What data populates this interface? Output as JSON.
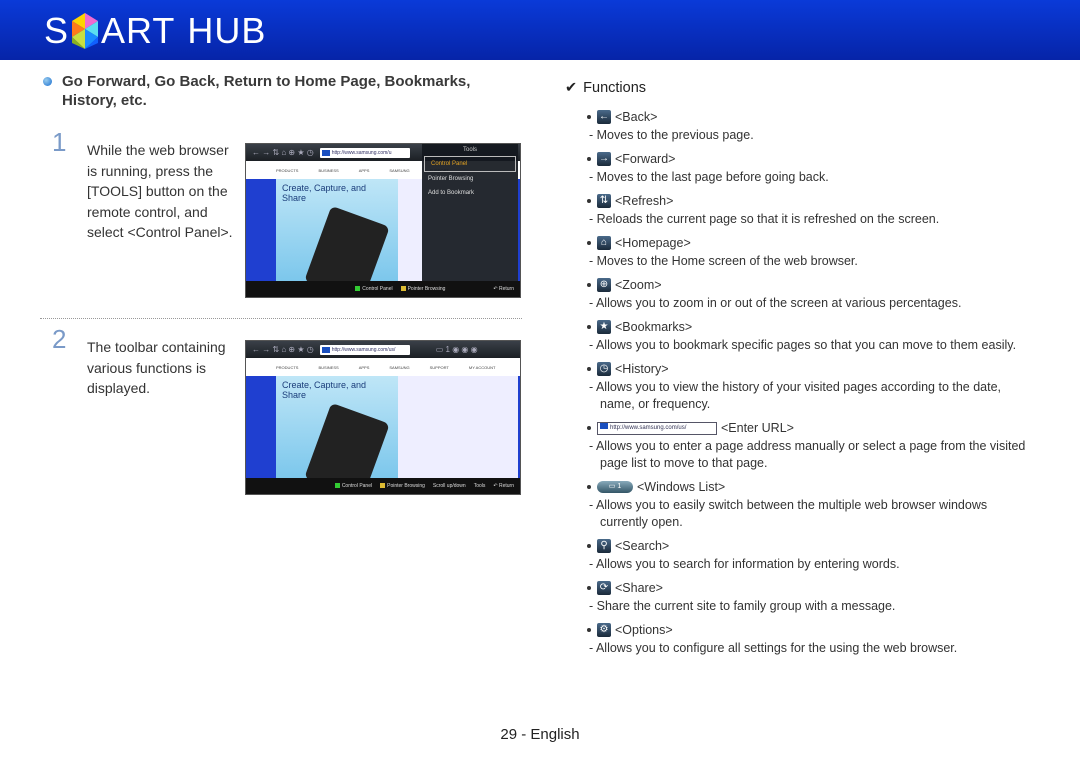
{
  "header": {
    "logo_text_1": "S",
    "logo_text_2": "ART",
    "logo_text_3": "HUB"
  },
  "section": {
    "heading": "Go Forward, Go Back, Return to Home Page, Bookmarks, History, etc."
  },
  "steps": [
    {
      "num": "1",
      "text_1": "While the web browser is running, press the [",
      "key": "TOOLS",
      "text_2": "] button on the remote control, and select <",
      "target": "Control Panel",
      "text_3": ">."
    },
    {
      "num": "2",
      "text": "The toolbar containing various functions is displayed."
    }
  ],
  "shot1": {
    "url": "http://www.samsung.com/u",
    "tools_title": "Tools",
    "menu": [
      "Control Panel",
      "Pointer Browsing",
      "Add to Bookmark"
    ],
    "hero": "Create, Capture, and Share",
    "nav": [
      "PRODUCTS",
      "BUSINESS",
      "APPS",
      "SAMSUNG",
      "SUPPORT"
    ],
    "bottom": [
      "Control Panel",
      "Pointer Browsing",
      "Return"
    ]
  },
  "shot2": {
    "url": "http://www.samsung.com/us/",
    "hero": "Create, Capture, and Share",
    "nav": [
      "PRODUCTS",
      "BUSINESS",
      "APPS",
      "SAMSUNG",
      "SUPPORT",
      "MY ACCOUNT"
    ],
    "bottom": [
      "Control Panel",
      "Pointer Browsing",
      "Scroll up/down",
      "Tools",
      "Return"
    ]
  },
  "functions": {
    "title": "Functions",
    "items": [
      {
        "icon": "back-arrow",
        "glyph": "←",
        "label": "<Back>",
        "desc": "Moves to the previous page."
      },
      {
        "icon": "forward-arrow",
        "glyph": "→",
        "label": "<Forward>",
        "desc": "Moves to the last page before going back."
      },
      {
        "icon": "refresh",
        "glyph": "⇅",
        "label": "<Refresh>",
        "desc": "Reloads the current page so that it is refreshed on the screen."
      },
      {
        "icon": "home",
        "glyph": "⌂",
        "label": "<Homepage>",
        "desc": "Moves to the Home screen of the web browser."
      },
      {
        "icon": "zoom",
        "glyph": "⊕",
        "label": "<Zoom>",
        "desc": "Allows you to zoom in or out of the screen at various percentages."
      },
      {
        "icon": "bookmark-star",
        "glyph": "★",
        "label": "<Bookmarks>",
        "desc": "Allows you to bookmark specific pages so that you can move to them easily."
      },
      {
        "icon": "history-clock",
        "glyph": "◷",
        "label": "<History>",
        "desc": "Allows you to view the history of your visited pages according to the date, name, or frequency."
      },
      {
        "icon": "url-field",
        "url": "http://www.samsung.com/us/",
        "label": "<Enter URL>",
        "desc": "Allows you to enter a page address manually or select a page from the visited page list to move to that page."
      },
      {
        "icon": "windows-list",
        "count": "1",
        "label": "<Windows List>",
        "desc": "Allows you to easily switch between the multiple web browser windows currently open."
      },
      {
        "icon": "search",
        "glyph": "⚲",
        "label": "<Search>",
        "desc": "Allows you to search for information by entering words."
      },
      {
        "icon": "share",
        "glyph": "⟳",
        "label": "<Share>",
        "desc": "Share the current site to family group with a message."
      },
      {
        "icon": "options-gear",
        "glyph": "⚙",
        "label": "<Options>",
        "desc": "Allows you to configure all settings for the using the web browser."
      }
    ]
  },
  "footer": {
    "page": "29 - English"
  },
  "colors": {
    "header": "#0a3ad8",
    "step_number": "#7a9ac8"
  }
}
